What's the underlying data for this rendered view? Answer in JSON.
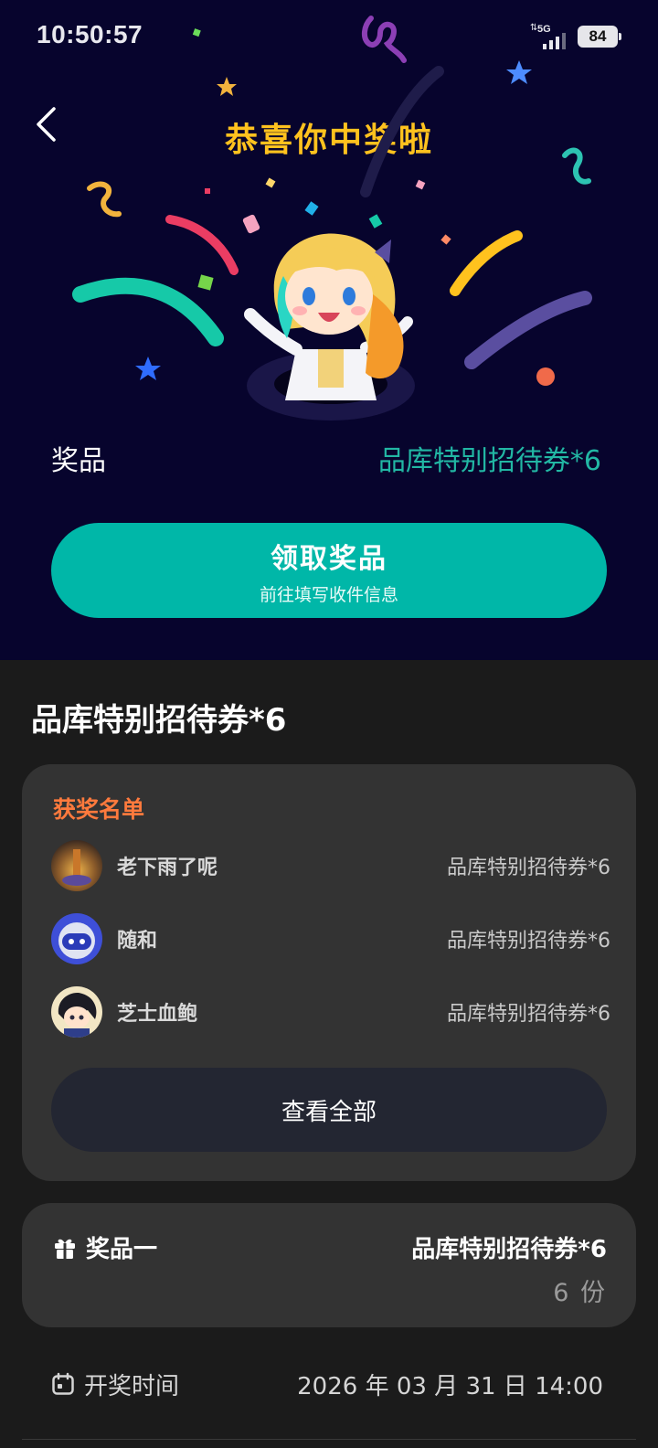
{
  "status_bar": {
    "time": "10:50:57",
    "network": "5G",
    "battery": "84"
  },
  "hero": {
    "title": "恭喜你中奖啦",
    "prize_label": "奖品",
    "prize_value": "品库特别招待券*6",
    "claim_button": {
      "label": "领取奖品",
      "sub_label": "前往填写收件信息"
    }
  },
  "section_heading": "品库特别招待券*6",
  "winners": {
    "title": "获奖名单",
    "items": [
      {
        "name": "老下雨了呢",
        "prize": "品库特别招待券*6"
      },
      {
        "name": "随和",
        "prize": "品库特别招待券*6"
      },
      {
        "name": "芝士血鲍",
        "prize": "品库特别招待券*6"
      }
    ],
    "view_all": "查看全部"
  },
  "prize_card": {
    "label": "奖品一",
    "name": "品库特别招待券*6",
    "quantity": "6 份"
  },
  "draw": {
    "label": "开奖时间",
    "value": "2026 年 03 月 31 日 14:00"
  },
  "colors": {
    "hero_background": "#07042d",
    "title_yellow": "#ffc21e",
    "accent_teal": "#00b7a8",
    "prize_teal_text": "#22b7a4",
    "winners_title_orange": "#ff7a3d",
    "card_background": "#333333",
    "page_background": "#1b1b1b"
  },
  "icons": {
    "back": "chevron-left-icon",
    "gift": "gift-icon",
    "calendar": "calendar-icon"
  }
}
